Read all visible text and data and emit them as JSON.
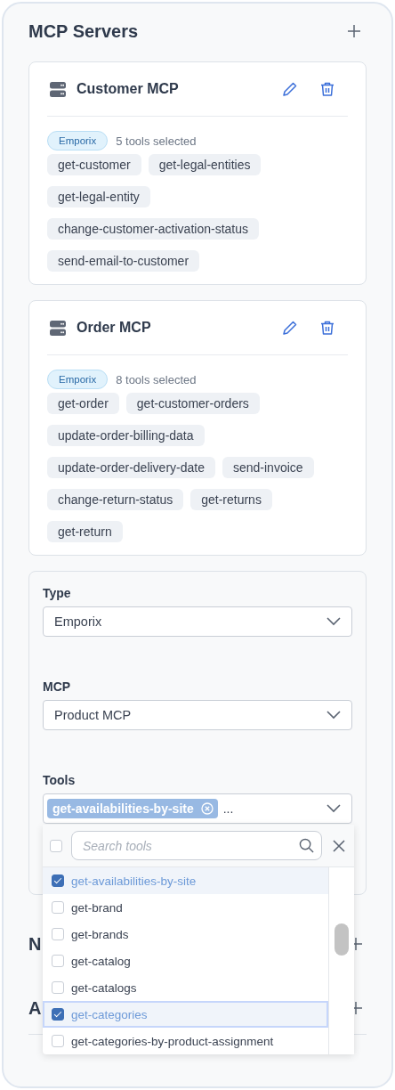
{
  "panel": {
    "title": "MCP Servers"
  },
  "servers": [
    {
      "name": "Customer MCP",
      "type": "Emporix",
      "tools_count": "5 tools selected",
      "tools": [
        "get-customer",
        "get-legal-entities",
        "get-legal-entity",
        "change-customer-activation-status",
        "send-email-to-customer"
      ]
    },
    {
      "name": "Order MCP",
      "type": "Emporix",
      "tools_count": "8 tools selected",
      "tools": [
        "get-order",
        "get-customer-orders",
        "update-order-billing-data",
        "update-order-delivery-date",
        "send-invoice",
        "change-return-status",
        "get-returns",
        "get-return"
      ]
    }
  ],
  "form": {
    "fields": [
      {
        "label": "Type",
        "value": "Emporix"
      },
      {
        "label": "MCP",
        "value": "Product MCP"
      }
    ],
    "tools_field": {
      "label": "Tools",
      "chips": [
        "get-availabilities-by-site"
      ],
      "overflow": "..."
    },
    "dropdown": {
      "select_all_checked": false,
      "search_placeholder": "Search tools",
      "options": [
        {
          "label": "get-availabilities-by-site",
          "checked": true,
          "focused": false
        },
        {
          "label": "get-brand",
          "checked": false,
          "focused": false
        },
        {
          "label": "get-brands",
          "checked": false,
          "focused": false
        },
        {
          "label": "get-catalog",
          "checked": false,
          "focused": false
        },
        {
          "label": "get-catalogs",
          "checked": false,
          "focused": false
        },
        {
          "label": "get-categories",
          "checked": true,
          "focused": true
        },
        {
          "label": "get-categories-by-product-assignment",
          "checked": false,
          "focused": false
        }
      ]
    }
  },
  "sections": [
    {
      "title": "N"
    },
    {
      "title": "A"
    }
  ]
}
